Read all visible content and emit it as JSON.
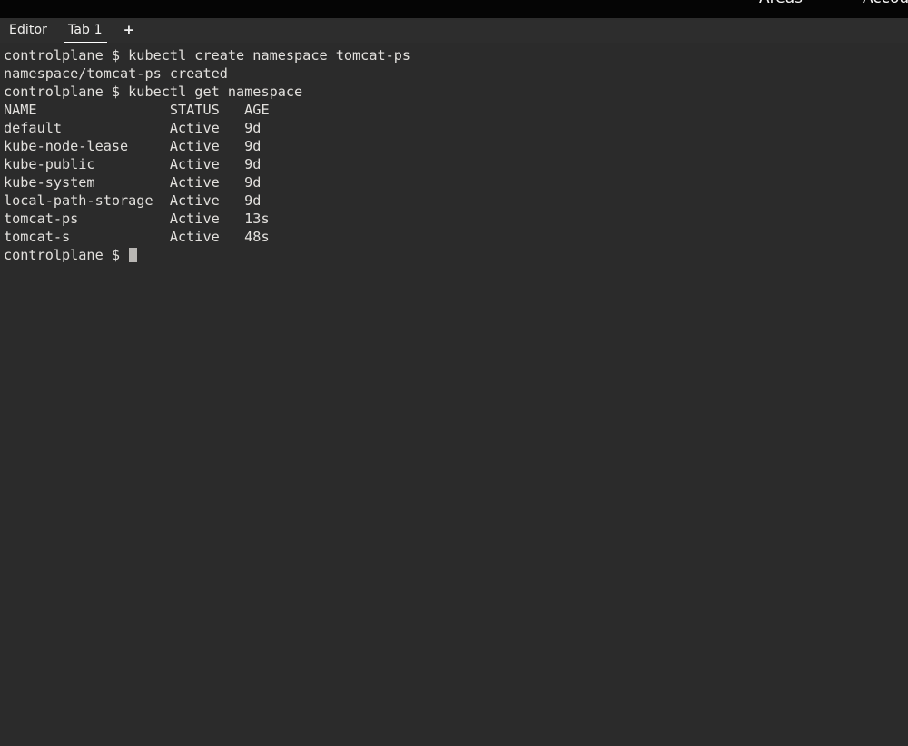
{
  "top_nav": {
    "items": [
      {
        "label": "Areas",
        "name": "top-nav-areas"
      },
      {
        "label": "Accou",
        "name": "top-nav-account"
      }
    ],
    "areas_label": "Areas",
    "account_label": "Accou"
  },
  "tabbar": {
    "editor_label": "Editor",
    "tabs": [
      {
        "label": "Tab 1",
        "active": true
      }
    ],
    "active_tab_label": "Tab 1",
    "add_tab_label": "+",
    "background_color": "#2d2d2d"
  },
  "terminal": {
    "background_color": "#2b2b2b",
    "text_color": "#e2e0dd",
    "prompt": "controlplane $",
    "lines": [
      "controlplane $ kubectl create namespace tomcat-ps",
      "namespace/tomcat-ps created",
      "controlplane $ kubectl get namespace",
      "NAME                STATUS   AGE",
      "default             Active   9d",
      "kube-node-lease     Active   9d",
      "kube-public         Active   9d",
      "kube-system         Active   9d",
      "local-path-storage  Active   9d",
      "tomcat-ps           Active   13s",
      "tomcat-s            Active   48s"
    ],
    "last_line": "controlplane $ ",
    "commands": [
      "kubectl create namespace tomcat-ps",
      "kubectl get namespace"
    ],
    "namespace_table": {
      "headers": [
        "NAME",
        "STATUS",
        "AGE"
      ],
      "rows": [
        [
          "default",
          "Active",
          "9d"
        ],
        [
          "kube-node-lease",
          "Active",
          "9d"
        ],
        [
          "kube-public",
          "Active",
          "9d"
        ],
        [
          "kube-system",
          "Active",
          "9d"
        ],
        [
          "local-path-storage",
          "Active",
          "9d"
        ],
        [
          "tomcat-ps",
          "Active",
          "13s"
        ],
        [
          "tomcat-s",
          "Active",
          "48s"
        ]
      ]
    },
    "create_output": "namespace/tomcat-ps created"
  }
}
